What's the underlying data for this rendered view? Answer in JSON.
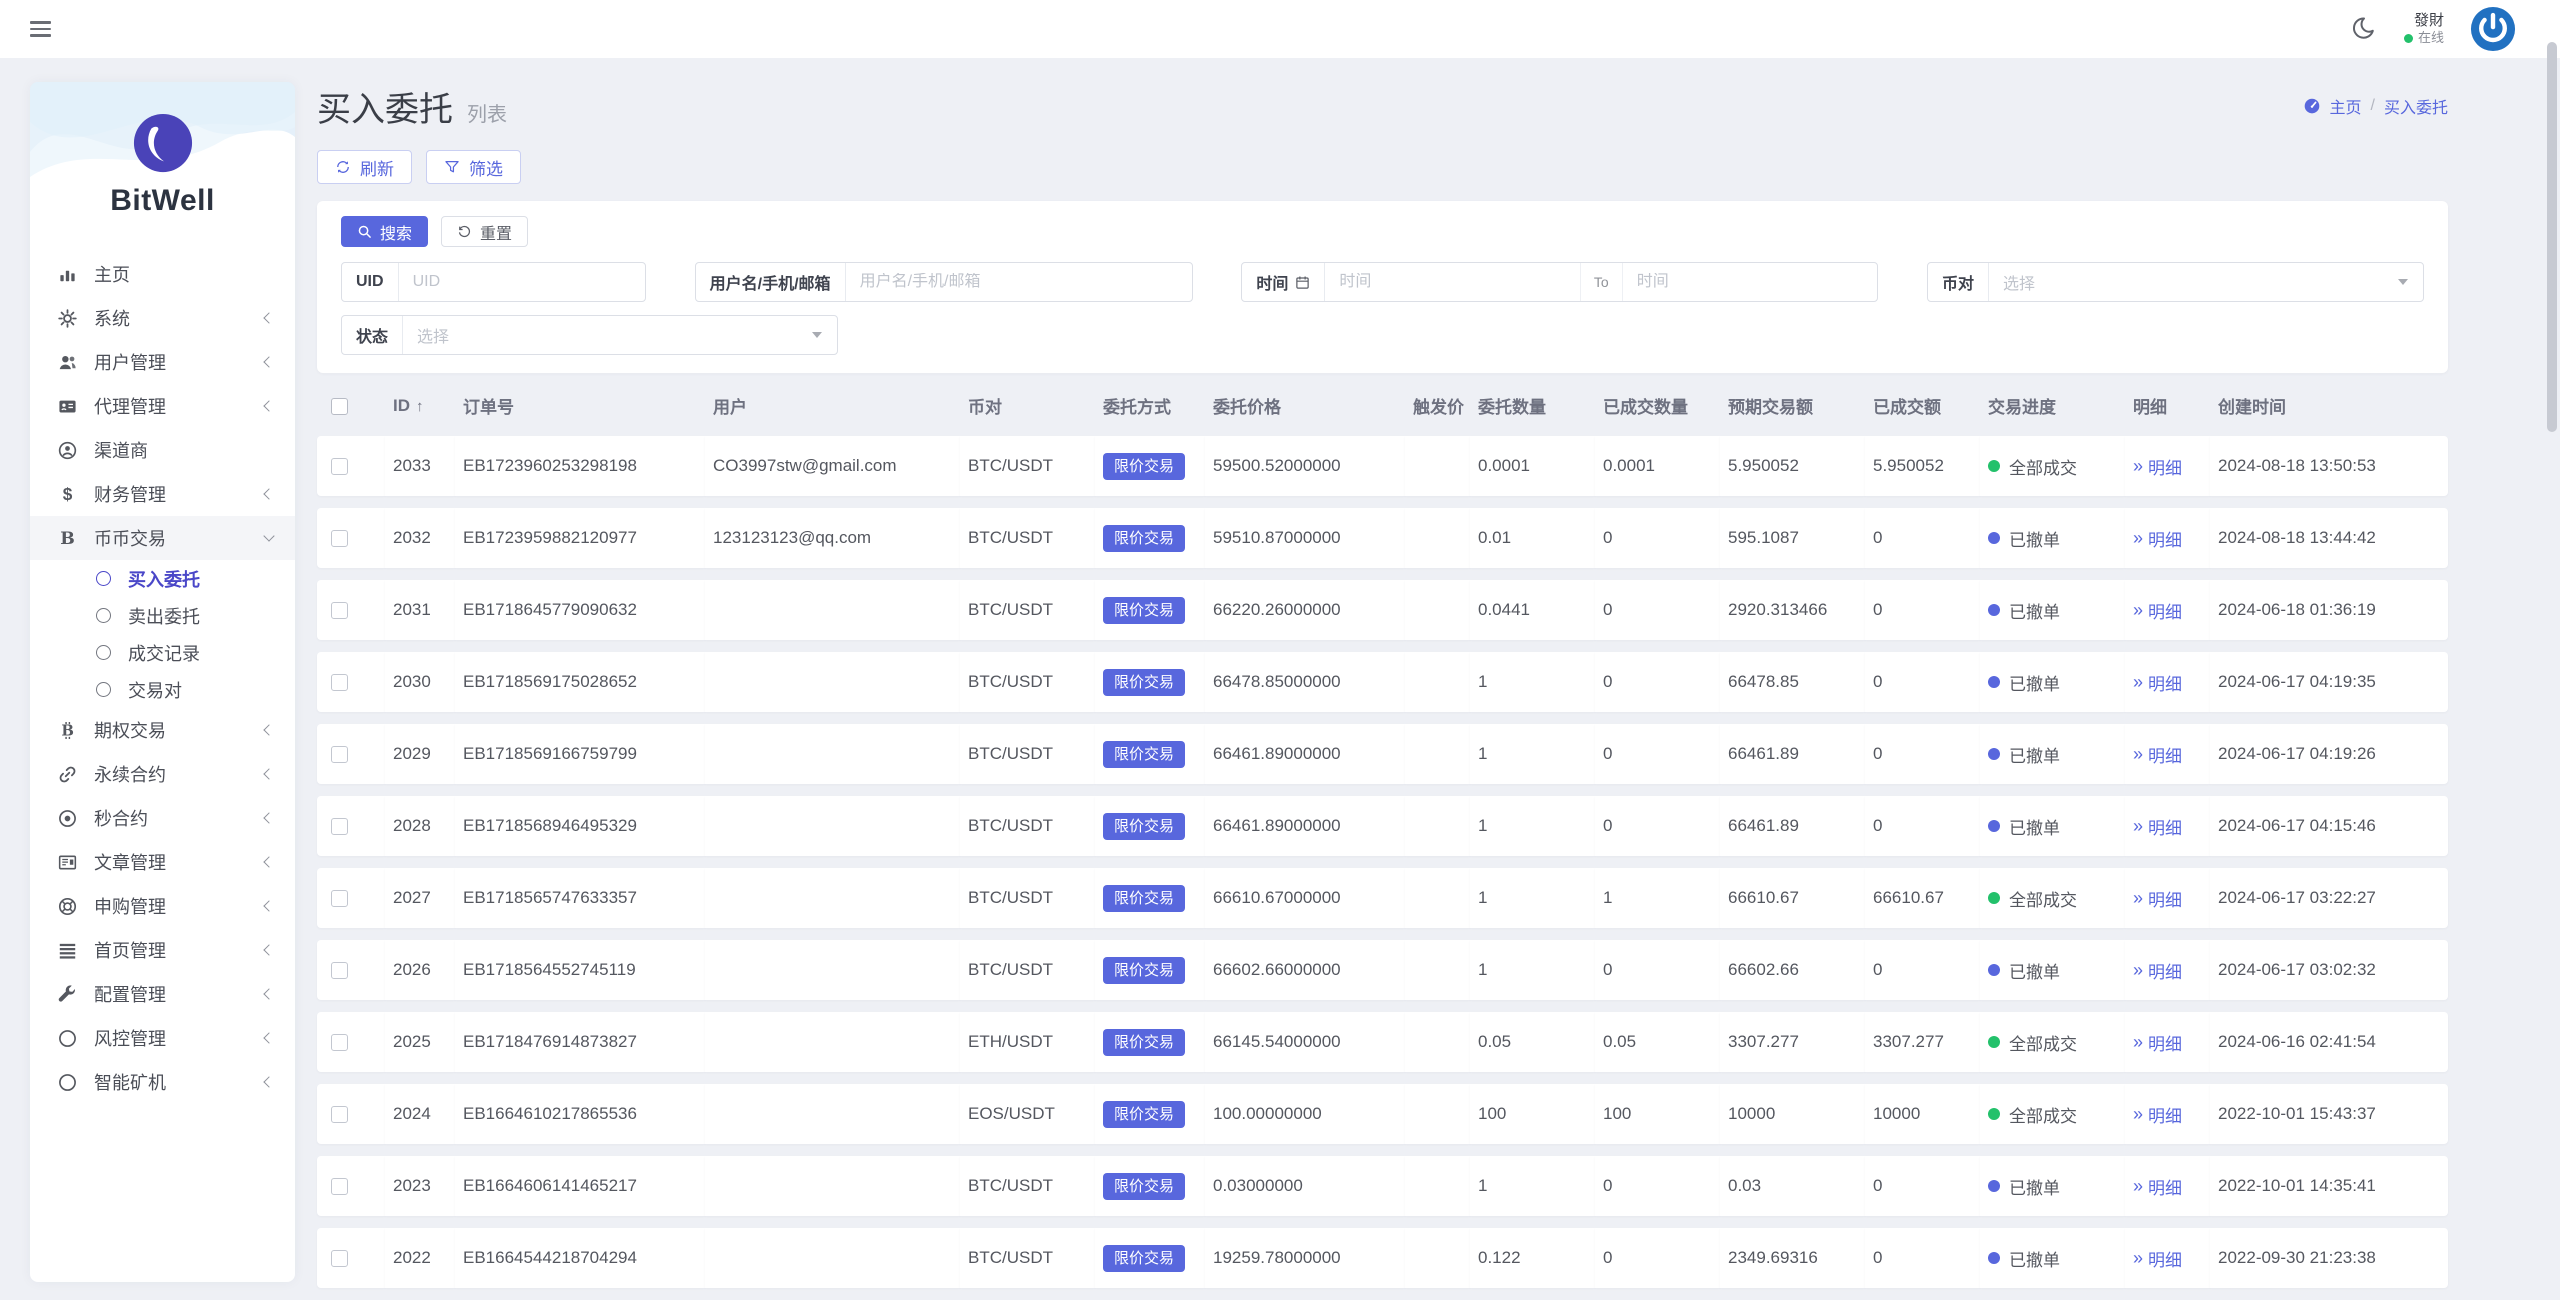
{
  "colors": {
    "accent": "#5867dd",
    "green": "#23c16b",
    "page_bg": "#eef0f5",
    "badge_bg": "#5867dd",
    "cancel_dot": "#5867dd"
  },
  "topbar": {
    "user_name": "發財",
    "user_status": "在线"
  },
  "sidebar": {
    "brand": "BitWell",
    "items": [
      {
        "icon": "chart-bars",
        "label": "主页"
      },
      {
        "icon": "gear",
        "label": "系统",
        "chevron": "left"
      },
      {
        "icon": "users",
        "label": "用户管理",
        "chevron": "left"
      },
      {
        "icon": "id-card",
        "label": "代理管理",
        "chevron": "left"
      },
      {
        "icon": "person",
        "label": "渠道商"
      },
      {
        "icon": "dollar",
        "label": "财务管理",
        "chevron": "left"
      },
      {
        "icon": "letter-b",
        "label": "币币交易",
        "chevron": "down",
        "expanded": true,
        "children": [
          {
            "label": "买入委托",
            "active": true
          },
          {
            "label": "卖出委托"
          },
          {
            "label": "成交记录"
          },
          {
            "label": "交易对"
          }
        ]
      },
      {
        "icon": "bitcoin",
        "label": "期权交易",
        "chevron": "left"
      },
      {
        "icon": "link",
        "label": "永续合约",
        "chevron": "left"
      },
      {
        "icon": "target",
        "label": "秒合约",
        "chevron": "left"
      },
      {
        "icon": "news",
        "label": "文章管理",
        "chevron": "left"
      },
      {
        "icon": "lifebuoy",
        "label": "申购管理",
        "chevron": "left"
      },
      {
        "icon": "lines",
        "label": "首页管理",
        "chevron": "left"
      },
      {
        "icon": "wrench",
        "label": "配置管理",
        "chevron": "left"
      },
      {
        "icon": "circle",
        "label": "风控管理",
        "chevron": "left"
      },
      {
        "icon": "circle",
        "label": "智能矿机",
        "chevron": "left"
      }
    ]
  },
  "page": {
    "title": "买入委托",
    "subtitle": "列表",
    "breadcrumb_home": "主页",
    "breadcrumb_separator": "/",
    "breadcrumb_current": "买入委托"
  },
  "toolbar": {
    "refresh": "刷新",
    "filter": "筛选"
  },
  "search": {
    "search": "搜索",
    "reset": "重置",
    "uid_label": "UID",
    "uid_placeholder": "UID",
    "user_label": "用户名/手机/邮箱",
    "user_placeholder": "用户名/手机/邮箱",
    "time_label": "时间",
    "time_from_placeholder": "时间",
    "time_separator": "To",
    "time_to_placeholder": "时间",
    "pair_label": "币对",
    "pair_placeholder": "选择",
    "status_label": "状态",
    "status_placeholder": "选择"
  },
  "table": {
    "headers": [
      "ID",
      "订单号",
      "用户",
      "币对",
      "委托方式",
      "委托价格",
      "触发价",
      "委托数量",
      "已成交数量",
      "预期交易额",
      "已成交额",
      "交易进度",
      "明细",
      "创建时间"
    ],
    "sort_indicator": "↑",
    "detail_prefix": "»",
    "rows": [
      {
        "id": "2033",
        "order_no": "EB1723960253298198",
        "user": "CO3997stw@gmail.com",
        "pair": "BTC/USDT",
        "type": "限价交易",
        "price": "59500.52000000",
        "trigger": "",
        "amount": "0.0001",
        "filled_amount": "0.0001",
        "expected": "5.950052",
        "filled_value": "5.950052",
        "status": "全部成交",
        "status_color": "green",
        "detail": "明细",
        "created": "2024-08-18 13:50:53"
      },
      {
        "id": "2032",
        "order_no": "EB1723959882120977",
        "user": "123123123@qq.com",
        "pair": "BTC/USDT",
        "type": "限价交易",
        "price": "59510.87000000",
        "trigger": "",
        "amount": "0.01",
        "filled_amount": "0",
        "expected": "595.1087",
        "filled_value": "0",
        "status": "已撤单",
        "status_color": "blue",
        "detail": "明细",
        "created": "2024-08-18 13:44:42"
      },
      {
        "id": "2031",
        "order_no": "EB1718645779090632",
        "user": "",
        "pair": "BTC/USDT",
        "type": "限价交易",
        "price": "66220.26000000",
        "trigger": "",
        "amount": "0.0441",
        "filled_amount": "0",
        "expected": "2920.313466",
        "filled_value": "0",
        "status": "已撤单",
        "status_color": "blue",
        "detail": "明细",
        "created": "2024-06-18 01:36:19"
      },
      {
        "id": "2030",
        "order_no": "EB1718569175028652",
        "user": "",
        "pair": "BTC/USDT",
        "type": "限价交易",
        "price": "66478.85000000",
        "trigger": "",
        "amount": "1",
        "filled_amount": "0",
        "expected": "66478.85",
        "filled_value": "0",
        "status": "已撤单",
        "status_color": "blue",
        "detail": "明细",
        "created": "2024-06-17 04:19:35"
      },
      {
        "id": "2029",
        "order_no": "EB1718569166759799",
        "user": "",
        "pair": "BTC/USDT",
        "type": "限价交易",
        "price": "66461.89000000",
        "trigger": "",
        "amount": "1",
        "filled_amount": "0",
        "expected": "66461.89",
        "filled_value": "0",
        "status": "已撤单",
        "status_color": "blue",
        "detail": "明细",
        "created": "2024-06-17 04:19:26"
      },
      {
        "id": "2028",
        "order_no": "EB1718568946495329",
        "user": "",
        "pair": "BTC/USDT",
        "type": "限价交易",
        "price": "66461.89000000",
        "trigger": "",
        "amount": "1",
        "filled_amount": "0",
        "expected": "66461.89",
        "filled_value": "0",
        "status": "已撤单",
        "status_color": "blue",
        "detail": "明细",
        "created": "2024-06-17 04:15:46"
      },
      {
        "id": "2027",
        "order_no": "EB1718565747633357",
        "user": "",
        "pair": "BTC/USDT",
        "type": "限价交易",
        "price": "66610.67000000",
        "trigger": "",
        "amount": "1",
        "filled_amount": "1",
        "expected": "66610.67",
        "filled_value": "66610.67",
        "status": "全部成交",
        "status_color": "green",
        "detail": "明细",
        "created": "2024-06-17 03:22:27"
      },
      {
        "id": "2026",
        "order_no": "EB1718564552745119",
        "user": "",
        "pair": "BTC/USDT",
        "type": "限价交易",
        "price": "66602.66000000",
        "trigger": "",
        "amount": "1",
        "filled_amount": "0",
        "expected": "66602.66",
        "filled_value": "0",
        "status": "已撤单",
        "status_color": "blue",
        "detail": "明细",
        "created": "2024-06-17 03:02:32"
      },
      {
        "id": "2025",
        "order_no": "EB1718476914873827",
        "user": "",
        "pair": "ETH/USDT",
        "type": "限价交易",
        "price": "66145.54000000",
        "trigger": "",
        "amount": "0.05",
        "filled_amount": "0.05",
        "expected": "3307.277",
        "filled_value": "3307.277",
        "status": "全部成交",
        "status_color": "green",
        "detail": "明细",
        "created": "2024-06-16 02:41:54"
      },
      {
        "id": "2024",
        "order_no": "EB1664610217865536",
        "user": "",
        "pair": "EOS/USDT",
        "type": "限价交易",
        "price": "100.00000000",
        "trigger": "",
        "amount": "100",
        "filled_amount": "100",
        "expected": "10000",
        "filled_value": "10000",
        "status": "全部成交",
        "status_color": "green",
        "detail": "明细",
        "created": "2022-10-01 15:43:37"
      },
      {
        "id": "2023",
        "order_no": "EB1664606141465217",
        "user": "",
        "pair": "BTC/USDT",
        "type": "限价交易",
        "price": "0.03000000",
        "trigger": "",
        "amount": "1",
        "filled_amount": "0",
        "expected": "0.03",
        "filled_value": "0",
        "status": "已撤单",
        "status_color": "blue",
        "detail": "明细",
        "created": "2022-10-01 14:35:41"
      },
      {
        "id": "2022",
        "order_no": "EB1664544218704294",
        "user": "",
        "pair": "BTC/USDT",
        "type": "限价交易",
        "price": "19259.78000000",
        "trigger": "",
        "amount": "0.122",
        "filled_amount": "0",
        "expected": "2349.69316",
        "filled_value": "0",
        "status": "已撤单",
        "status_color": "blue",
        "detail": "明细",
        "created": "2022-09-30 21:23:38"
      }
    ]
  }
}
